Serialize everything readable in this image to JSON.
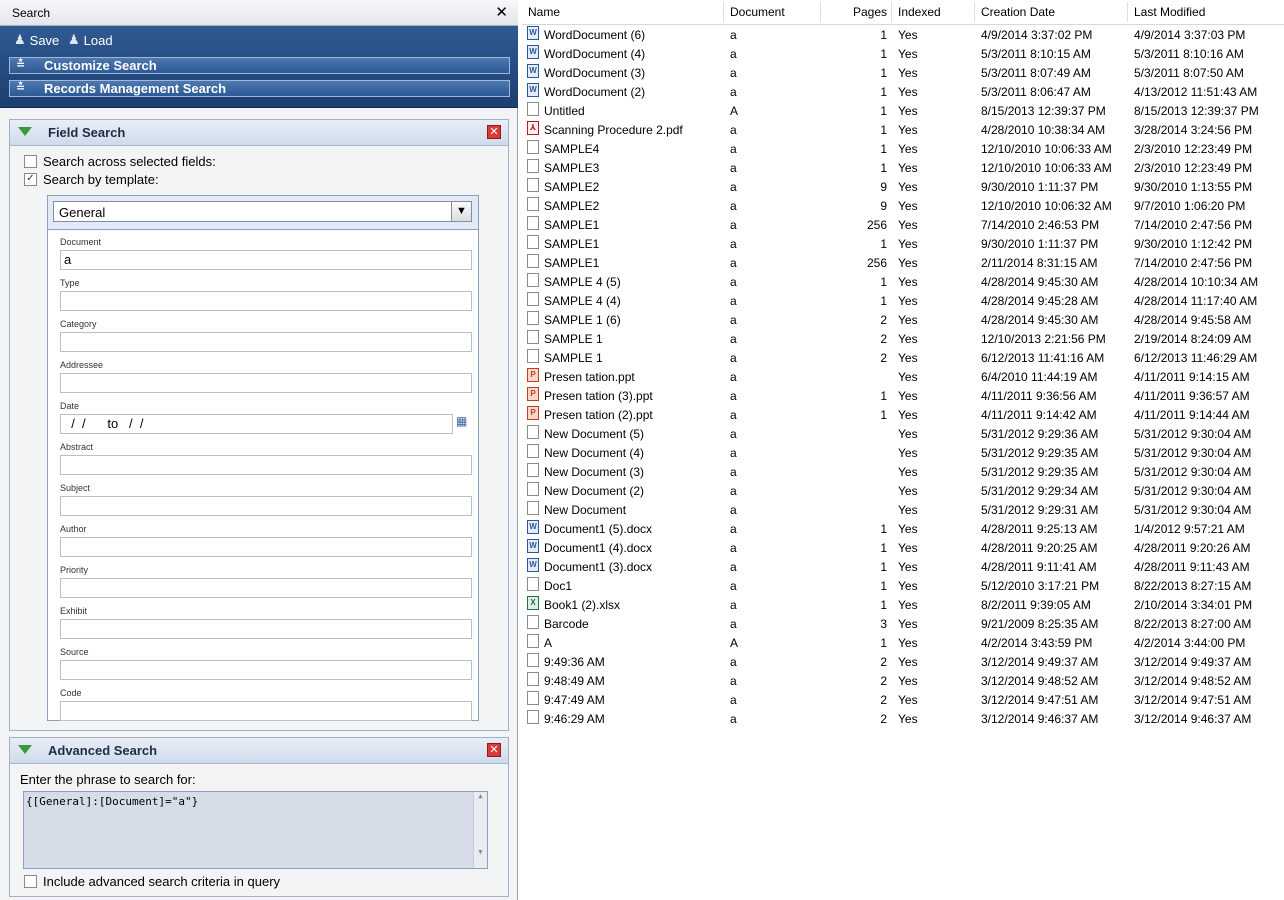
{
  "search_panel": {
    "title": "Search",
    "close_glyph": "✕",
    "toolbar": {
      "save_label": "Save",
      "load_label": "Load",
      "save_icon": "user-save-icon",
      "load_icon": "user-load-icon"
    },
    "sections": [
      "Customize Search",
      "Records Management Search"
    ],
    "field_search": {
      "title": "Field Search",
      "option_selected_fields": "Search across selected fields:",
      "option_selected_fields_checked": false,
      "option_by_template": "Search by template:",
      "option_by_template_checked": true,
      "template_selected": "General",
      "fields": [
        {
          "label": "Document",
          "value": "a"
        },
        {
          "label": "Type",
          "value": ""
        },
        {
          "label": "Category",
          "value": ""
        },
        {
          "label": "Addressee",
          "value": ""
        },
        {
          "label": "Date",
          "value": "  /  /      to   /  /"
        },
        {
          "label": "Abstract",
          "value": ""
        },
        {
          "label": "Subject",
          "value": ""
        },
        {
          "label": "Author",
          "value": ""
        },
        {
          "label": "Priority",
          "value": ""
        },
        {
          "label": "Exhibit",
          "value": ""
        },
        {
          "label": "Source",
          "value": ""
        },
        {
          "label": "Code",
          "value": ""
        }
      ]
    },
    "advanced_search": {
      "title": "Advanced Search",
      "prompt": "Enter the phrase to search for:",
      "query": "{[General]:[Document]=\"a\"}",
      "include_label": "Include advanced search criteria in query",
      "include_checked": false
    }
  },
  "results": {
    "columns": [
      "Name",
      "Document",
      "Pages",
      "Indexed",
      "Creation Date",
      "Last Modified"
    ],
    "rows": [
      {
        "icon": "word",
        "name": "WordDocument (6)",
        "document": "a",
        "pages": "1",
        "indexed": "Yes",
        "created": "4/9/2014 3:37:02 PM",
        "modified": "4/9/2014 3:37:03 PM"
      },
      {
        "icon": "word",
        "name": "WordDocument (4)",
        "document": "a",
        "pages": "1",
        "indexed": "Yes",
        "created": "5/3/2011 8:10:15 AM",
        "modified": "5/3/2011 8:10:16 AM"
      },
      {
        "icon": "word",
        "name": "WordDocument (3)",
        "document": "a",
        "pages": "1",
        "indexed": "Yes",
        "created": "5/3/2011 8:07:49 AM",
        "modified": "5/3/2011 8:07:50 AM"
      },
      {
        "icon": "word",
        "name": "WordDocument (2)",
        "document": "a",
        "pages": "1",
        "indexed": "Yes",
        "created": "5/3/2011 8:06:47 AM",
        "modified": "4/13/2012 11:51:43 AM"
      },
      {
        "icon": "doc",
        "name": "Untitled",
        "document": "A",
        "pages": "1",
        "indexed": "Yes",
        "created": "8/15/2013 12:39:37 PM",
        "modified": "8/15/2013 12:39:37 PM"
      },
      {
        "icon": "pdf",
        "name": "Scanning Procedure 2.pdf",
        "document": "a",
        "pages": "1",
        "indexed": "Yes",
        "created": "4/28/2010 10:38:34 AM",
        "modified": "3/28/2014 3:24:56 PM"
      },
      {
        "icon": "doc",
        "name": "SAMPLE4",
        "document": "a",
        "pages": "1",
        "indexed": "Yes",
        "created": "12/10/2010 10:06:33 AM",
        "modified": "2/3/2010 12:23:49 PM"
      },
      {
        "icon": "doc",
        "name": "SAMPLE3",
        "document": "a",
        "pages": "1",
        "indexed": "Yes",
        "created": "12/10/2010 10:06:33 AM",
        "modified": "2/3/2010 12:23:49 PM"
      },
      {
        "icon": "doc",
        "name": "SAMPLE2",
        "document": "a",
        "pages": "9",
        "indexed": "Yes",
        "created": "9/30/2010 1:11:37 PM",
        "modified": "9/30/2010 1:13:55 PM"
      },
      {
        "icon": "doc",
        "name": "SAMPLE2",
        "document": "a",
        "pages": "9",
        "indexed": "Yes",
        "created": "12/10/2010 10:06:32 AM",
        "modified": "9/7/2010 1:06:20 PM"
      },
      {
        "icon": "doc",
        "name": "SAMPLE1",
        "document": "a",
        "pages": "256",
        "indexed": "Yes",
        "created": "7/14/2010 2:46:53 PM",
        "modified": "7/14/2010 2:47:56 PM"
      },
      {
        "icon": "doc",
        "name": "SAMPLE1",
        "document": "a",
        "pages": "1",
        "indexed": "Yes",
        "created": "9/30/2010 1:11:37 PM",
        "modified": "9/30/2010 1:12:42 PM"
      },
      {
        "icon": "doc",
        "name": "SAMPLE1",
        "document": "a",
        "pages": "256",
        "indexed": "Yes",
        "created": "2/11/2014 8:31:15 AM",
        "modified": "7/14/2010 2:47:56 PM"
      },
      {
        "icon": "doc",
        "name": "SAMPLE 4 (5)",
        "document": "a",
        "pages": "1",
        "indexed": "Yes",
        "created": "4/28/2014 9:45:30 AM",
        "modified": "4/28/2014 10:10:34 AM"
      },
      {
        "icon": "doc",
        "name": "SAMPLE 4 (4)",
        "document": "a",
        "pages": "1",
        "indexed": "Yes",
        "created": "4/28/2014 9:45:28 AM",
        "modified": "4/28/2014 11:17:40 AM"
      },
      {
        "icon": "doc",
        "name": "SAMPLE 1 (6)",
        "document": "a",
        "pages": "2",
        "indexed": "Yes",
        "created": "4/28/2014 9:45:30 AM",
        "modified": "4/28/2014 9:45:58 AM"
      },
      {
        "icon": "doc",
        "name": "SAMPLE 1",
        "document": "a",
        "pages": "2",
        "indexed": "Yes",
        "created": "12/10/2013 2:21:56 PM",
        "modified": "2/19/2014 8:24:09 AM"
      },
      {
        "icon": "doc",
        "name": "SAMPLE 1",
        "document": "a",
        "pages": "2",
        "indexed": "Yes",
        "created": "6/12/2013 11:41:16 AM",
        "modified": "6/12/2013 11:46:29 AM"
      },
      {
        "icon": "ppt",
        "name": "Presen tation.ppt",
        "document": "a",
        "pages": "",
        "indexed": "Yes",
        "created": "6/4/2010 11:44:19 AM",
        "modified": "4/11/2011 9:14:15 AM"
      },
      {
        "icon": "ppt",
        "name": "Presen tation (3).ppt",
        "document": "a",
        "pages": "1",
        "indexed": "Yes",
        "created": "4/11/2011 9:36:56 AM",
        "modified": "4/11/2011 9:36:57 AM"
      },
      {
        "icon": "ppt",
        "name": "Presen tation (2).ppt",
        "document": "a",
        "pages": "1",
        "indexed": "Yes",
        "created": "4/11/2011 9:14:42 AM",
        "modified": "4/11/2011 9:14:44 AM"
      },
      {
        "icon": "doc",
        "name": "New Document (5)",
        "document": "a",
        "pages": "",
        "indexed": "Yes",
        "created": "5/31/2012 9:29:36 AM",
        "modified": "5/31/2012 9:30:04 AM"
      },
      {
        "icon": "doc",
        "name": "New Document (4)",
        "document": "a",
        "pages": "",
        "indexed": "Yes",
        "created": "5/31/2012 9:29:35 AM",
        "modified": "5/31/2012 9:30:04 AM"
      },
      {
        "icon": "doc",
        "name": "New Document (3)",
        "document": "a",
        "pages": "",
        "indexed": "Yes",
        "created": "5/31/2012 9:29:35 AM",
        "modified": "5/31/2012 9:30:04 AM"
      },
      {
        "icon": "doc",
        "name": "New Document (2)",
        "document": "a",
        "pages": "",
        "indexed": "Yes",
        "created": "5/31/2012 9:29:34 AM",
        "modified": "5/31/2012 9:30:04 AM"
      },
      {
        "icon": "doc",
        "name": "New Document",
        "document": "a",
        "pages": "",
        "indexed": "Yes",
        "created": "5/31/2012 9:29:31 AM",
        "modified": "5/31/2012 9:30:04 AM"
      },
      {
        "icon": "word",
        "name": "Document1 (5).docx",
        "document": "a",
        "pages": "1",
        "indexed": "Yes",
        "created": "4/28/2011 9:25:13 AM",
        "modified": "1/4/2012 9:57:21 AM"
      },
      {
        "icon": "word",
        "name": "Document1 (4).docx",
        "document": "a",
        "pages": "1",
        "indexed": "Yes",
        "created": "4/28/2011 9:20:25 AM",
        "modified": "4/28/2011 9:20:26 AM"
      },
      {
        "icon": "word",
        "name": "Document1 (3).docx",
        "document": "a",
        "pages": "1",
        "indexed": "Yes",
        "created": "4/28/2011 9:11:41 AM",
        "modified": "4/28/2011 9:11:43 AM"
      },
      {
        "icon": "doc",
        "name": "Doc1",
        "document": "a",
        "pages": "1",
        "indexed": "Yes",
        "created": "5/12/2010 3:17:21 PM",
        "modified": "8/22/2013 8:27:15 AM"
      },
      {
        "icon": "xls",
        "name": "Book1 (2).xlsx",
        "document": "a",
        "pages": "1",
        "indexed": "Yes",
        "created": "8/2/2011 9:39:05 AM",
        "modified": "2/10/2014 3:34:01 PM"
      },
      {
        "icon": "doc",
        "name": "Barcode",
        "document": "a",
        "pages": "3",
        "indexed": "Yes",
        "created": "9/21/2009 8:25:35 AM",
        "modified": "8/22/2013 8:27:00 AM"
      },
      {
        "icon": "doc",
        "name": "A",
        "document": "A",
        "pages": "1",
        "indexed": "Yes",
        "created": "4/2/2014 3:43:59 PM",
        "modified": "4/2/2014 3:44:00 PM"
      },
      {
        "icon": "doc",
        "name": "9:49:36 AM",
        "document": "a",
        "pages": "2",
        "indexed": "Yes",
        "created": "3/12/2014 9:49:37 AM",
        "modified": "3/12/2014 9:49:37 AM"
      },
      {
        "icon": "doc",
        "name": "9:48:49 AM",
        "document": "a",
        "pages": "2",
        "indexed": "Yes",
        "created": "3/12/2014 9:48:52 AM",
        "modified": "3/12/2014 9:48:52 AM"
      },
      {
        "icon": "doc",
        "name": "9:47:49 AM",
        "document": "a",
        "pages": "2",
        "indexed": "Yes",
        "created": "3/12/2014 9:47:51 AM",
        "modified": "3/12/2014 9:47:51 AM"
      },
      {
        "icon": "doc",
        "name": "9:46:29 AM",
        "document": "a",
        "pages": "2",
        "indexed": "Yes",
        "created": "3/12/2014 9:46:37 AM",
        "modified": "3/12/2014 9:46:37 AM"
      }
    ]
  }
}
